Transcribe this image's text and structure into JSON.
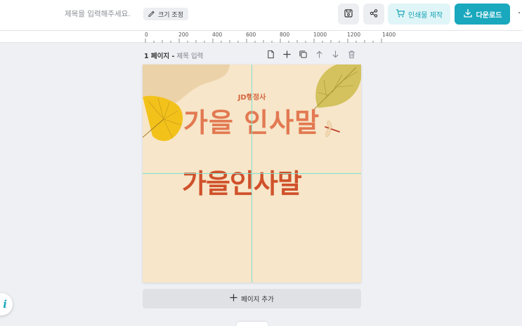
{
  "topbar": {
    "title_placeholder": "제목을 입력해주세요.",
    "resize_label": "크기 조정",
    "print_label": "인쇄물 제작",
    "download_label": "다운로드",
    "more_label": "·"
  },
  "ruler": {
    "ticks": [
      "0",
      "200",
      "400",
      "600",
      "800",
      "1000",
      "1200",
      "1400"
    ]
  },
  "page": {
    "number_label": "1 페이지 -",
    "title_placeholder": "제목 입력"
  },
  "canvas": {
    "brand": "JD행정사",
    "headline": "가을 인사말",
    "subline": "가을인사말",
    "colors": {
      "background": "#f7e6c9",
      "headline": "#e27952",
      "subline": "#d0512b",
      "guide": "#7fe0cf"
    }
  },
  "add_page": {
    "label": "페이지 추가"
  },
  "help": {
    "label": "i"
  },
  "colors": {
    "accent": "#19a8bd",
    "print_bg": "#e0f5f7"
  }
}
